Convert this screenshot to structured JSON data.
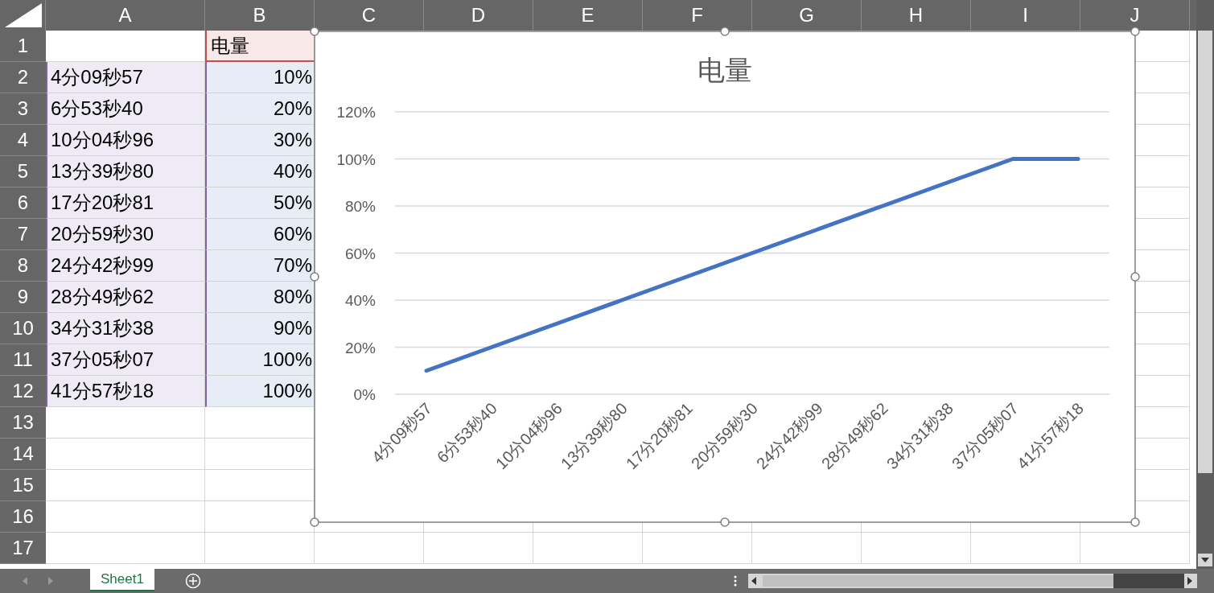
{
  "columns": [
    "A",
    "B",
    "C",
    "D",
    "E",
    "F",
    "G",
    "H",
    "I",
    "J"
  ],
  "rows": [
    {
      "number": "1",
      "cells": [
        {
          "text": "",
          "kind": "blank"
        },
        {
          "text": "电量",
          "kind": "series-name"
        }
      ]
    },
    {
      "number": "2",
      "cells": [
        {
          "text": "4分09秒57",
          "kind": "category"
        },
        {
          "text": "10%",
          "kind": "value"
        }
      ]
    },
    {
      "number": "3",
      "cells": [
        {
          "text": "6分53秒40",
          "kind": "category"
        },
        {
          "text": "20%",
          "kind": "value"
        }
      ]
    },
    {
      "number": "4",
      "cells": [
        {
          "text": "10分04秒96",
          "kind": "category"
        },
        {
          "text": "30%",
          "kind": "value"
        }
      ]
    },
    {
      "number": "5",
      "cells": [
        {
          "text": "13分39秒80",
          "kind": "category"
        },
        {
          "text": "40%",
          "kind": "value"
        }
      ]
    },
    {
      "number": "6",
      "cells": [
        {
          "text": "17分20秒81",
          "kind": "category"
        },
        {
          "text": "50%",
          "kind": "value"
        }
      ]
    },
    {
      "number": "7",
      "cells": [
        {
          "text": "20分59秒30",
          "kind": "category"
        },
        {
          "text": "60%",
          "kind": "value"
        }
      ]
    },
    {
      "number": "8",
      "cells": [
        {
          "text": "24分42秒99",
          "kind": "category"
        },
        {
          "text": "70%",
          "kind": "value"
        }
      ]
    },
    {
      "number": "9",
      "cells": [
        {
          "text": "28分49秒62",
          "kind": "category"
        },
        {
          "text": "80%",
          "kind": "value"
        }
      ]
    },
    {
      "number": "10",
      "cells": [
        {
          "text": "34分31秒38",
          "kind": "category"
        },
        {
          "text": "90%",
          "kind": "value"
        }
      ]
    },
    {
      "number": "11",
      "cells": [
        {
          "text": "37分05秒07",
          "kind": "category"
        },
        {
          "text": "100%",
          "kind": "value"
        }
      ]
    },
    {
      "number": "12",
      "cells": [
        {
          "text": "41分57秒18",
          "kind": "category"
        },
        {
          "text": "100%",
          "kind": "value"
        }
      ]
    },
    {
      "number": "13",
      "cells": []
    },
    {
      "number": "14",
      "cells": []
    },
    {
      "number": "15",
      "cells": []
    },
    {
      "number": "16",
      "cells": []
    },
    {
      "number": "17",
      "cells": []
    }
  ],
  "chart": {
    "chart_data": {
      "type": "line",
      "title": "电量",
      "categories": [
        "4分09秒57",
        "6分53秒40",
        "10分04秒96",
        "13分39秒80",
        "17分20秒81",
        "20分59秒30",
        "24分42秒99",
        "28分49秒62",
        "34分31秒38",
        "37分05秒07",
        "41分57秒18"
      ],
      "grid": true,
      "series": [
        {
          "color": "#4472c4",
          "values": [
            0.1,
            0.2,
            0.3,
            0.4,
            0.5,
            0.6,
            0.7,
            0.8,
            0.9,
            1.0,
            1.0
          ]
        }
      ],
      "ylim": [
        0,
        1.2
      ],
      "yticks": [
        {
          "value": 0,
          "label": "0%"
        },
        {
          "value": 0.2,
          "label": "20%"
        },
        {
          "value": 0.4,
          "label": "40%"
        },
        {
          "value": 0.6,
          "label": "60%"
        },
        {
          "value": 0.8,
          "label": "80%"
        },
        {
          "value": 1.0,
          "label": "100%"
        },
        {
          "value": 1.2,
          "label": "120%"
        }
      ]
    }
  },
  "sheet_tabs": [
    {
      "label": "Sheet1",
      "selected": true
    }
  ]
}
